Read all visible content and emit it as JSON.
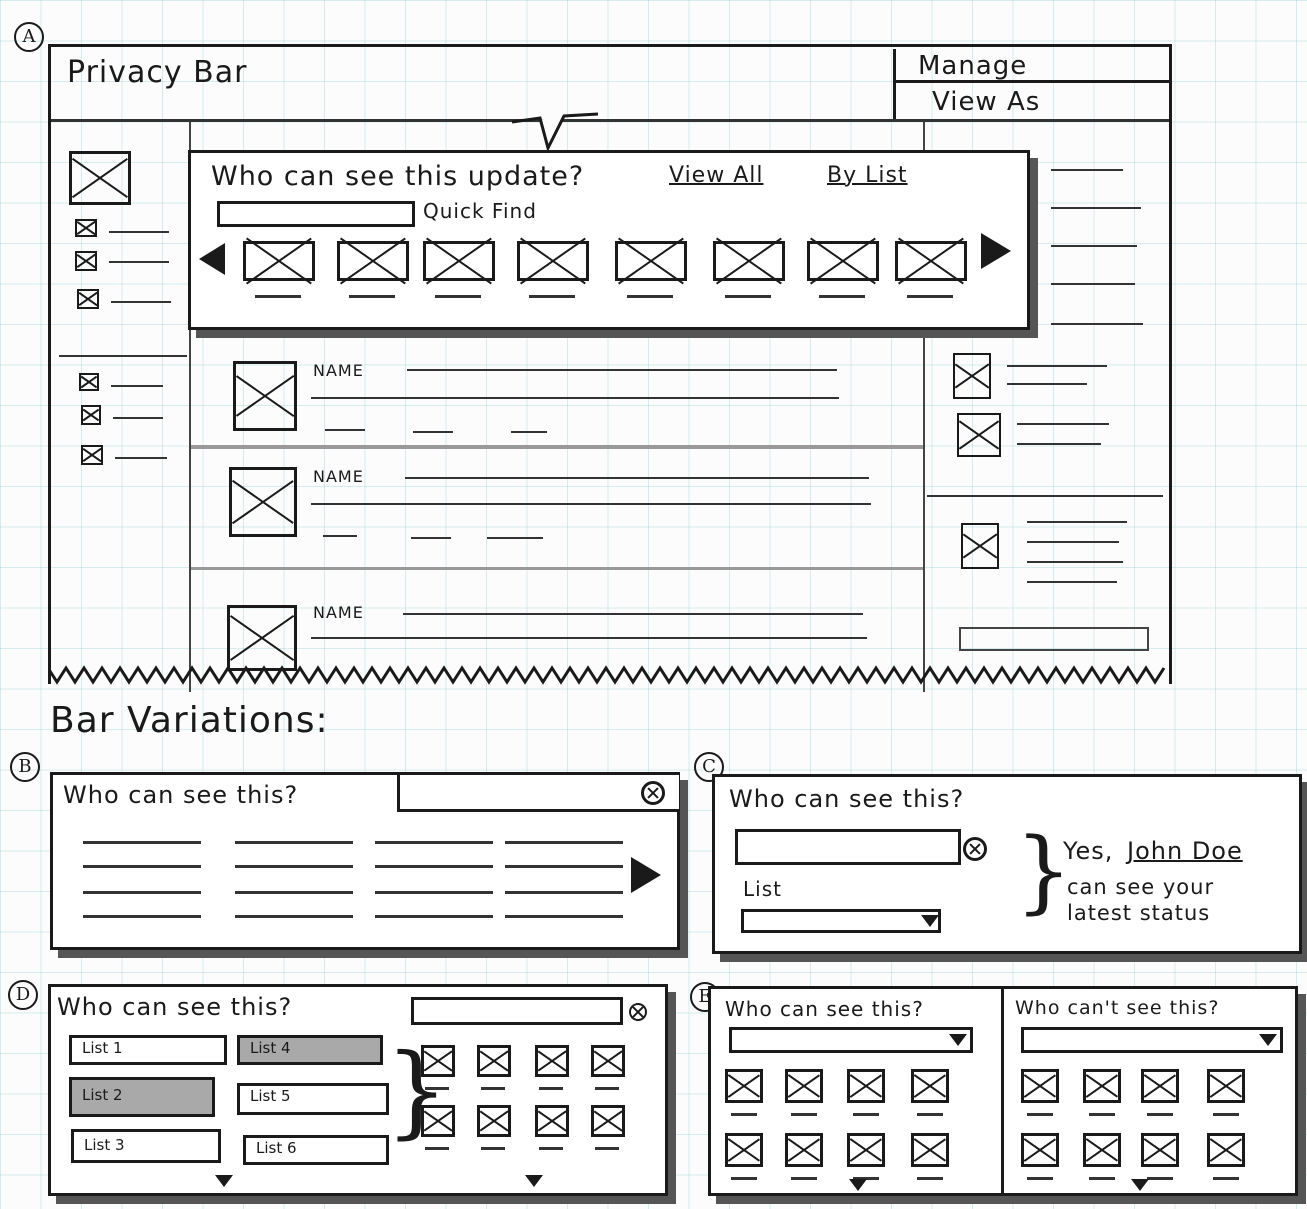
{
  "markers": {
    "a": "A",
    "b": "B",
    "c": "C",
    "d": "D",
    "e": "E"
  },
  "main_window": {
    "title": "Privacy Bar",
    "menu": {
      "manage": "Manage",
      "view_as": "View As"
    }
  },
  "popover": {
    "question": "Who can see this update?",
    "view_all": "View All",
    "by_list": "By List",
    "quick_find_label": "Quick Find"
  },
  "feed": {
    "names": [
      "NAME",
      "NAME",
      "NAME"
    ]
  },
  "variations_heading": "Bar Variations:",
  "variation_b": {
    "question": "Who can see this?"
  },
  "variation_c": {
    "question": "Who can see this?",
    "list_label": "List",
    "result_yes": "Yes,",
    "result_name": "John Doe",
    "result_line1": "can see your",
    "result_line2": "latest status"
  },
  "variation_d": {
    "question": "Who can see this?",
    "lists": [
      "List 1",
      "List 4",
      "List 2",
      "List 5",
      "List 3",
      "List 6"
    ],
    "selected": [
      "List 4",
      "List 2"
    ]
  },
  "variation_e": {
    "question_can": "Who can see this?",
    "question_cant": "Who can't see this?"
  },
  "colors": {
    "ink": "#1a1a1a",
    "grid": "#9fd3d8",
    "selected_fill": "#a9a9a9",
    "shadow": "#555555"
  }
}
